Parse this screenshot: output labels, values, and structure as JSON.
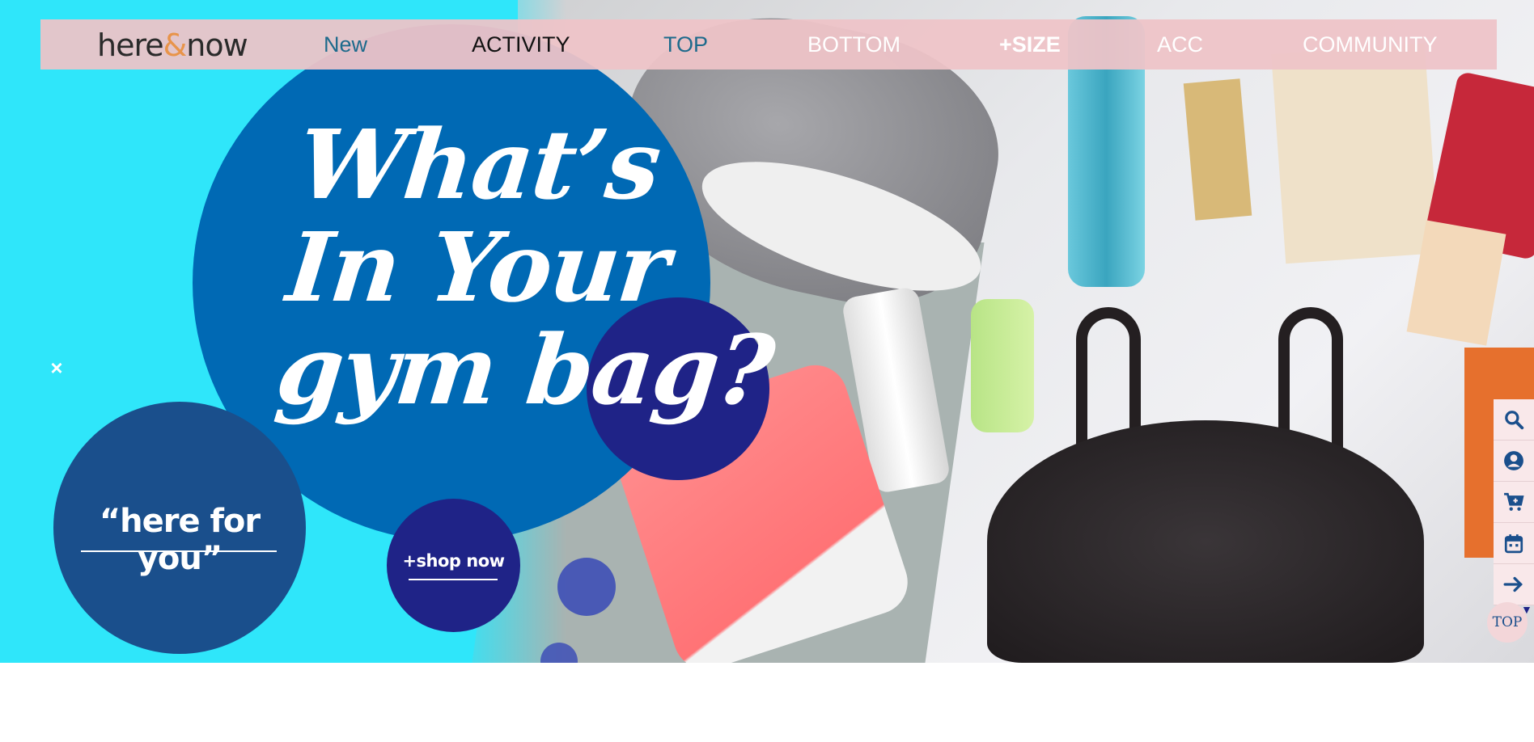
{
  "logo": {
    "text_before": "here",
    "amp": "&",
    "text_after": "now"
  },
  "nav": {
    "new": "New",
    "activity": "ACTIVITY",
    "top": "TOP",
    "bottom": "BOTTOM",
    "size": "+SIZE",
    "acc": "ACC",
    "community": "COMMUNITY"
  },
  "hero": {
    "headline_line1": "What’s",
    "headline_line2": "In Your",
    "headline_line3": "gym bag?",
    "quote": "“here for you”",
    "shop_label": "+shop now",
    "close_symbol": "×"
  },
  "side_rail": {
    "icons": [
      "search-icon",
      "user-icon",
      "cart-icon",
      "calendar-icon",
      "arrow-right-icon"
    ],
    "top_label": "TOP",
    "caret": "▼"
  },
  "colors": {
    "hero_cyan": "#2fe6fa",
    "circle_blue": "#0069b4",
    "circle_navy": "#1f2387",
    "circle_dark": "#1a4f8c",
    "nav_bg": "#eec4c8",
    "nav_teal": "#1d6a8c"
  }
}
